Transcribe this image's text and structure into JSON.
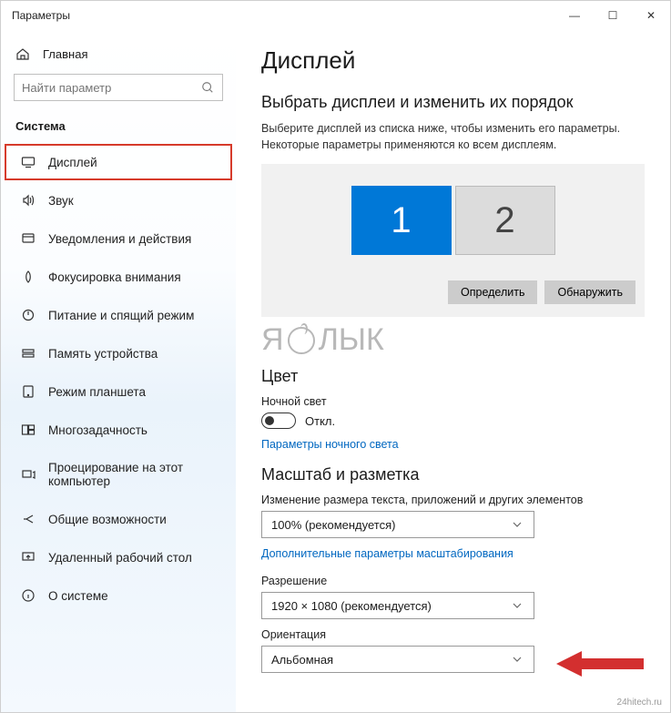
{
  "window": {
    "title": "Параметры"
  },
  "titlebar_buttons": {
    "min": "—",
    "max": "☐",
    "close": "✕"
  },
  "sidebar": {
    "home": "Главная",
    "search_placeholder": "Найти параметр",
    "section": "Система",
    "items": [
      {
        "label": "Дисплей",
        "icon": "display-icon",
        "active": true
      },
      {
        "label": "Звук",
        "icon": "sound-icon"
      },
      {
        "label": "Уведомления и действия",
        "icon": "notifications-icon"
      },
      {
        "label": "Фокусировка внимания",
        "icon": "focus-icon"
      },
      {
        "label": "Питание и спящий режим",
        "icon": "power-icon"
      },
      {
        "label": "Память устройства",
        "icon": "storage-icon"
      },
      {
        "label": "Режим планшета",
        "icon": "tablet-icon"
      },
      {
        "label": "Многозадачность",
        "icon": "multitask-icon"
      },
      {
        "label": "Проецирование на этот компьютер",
        "icon": "projecting-icon"
      },
      {
        "label": "Общие возможности",
        "icon": "shared-icon"
      },
      {
        "label": "Удаленный рабочий стол",
        "icon": "remote-icon"
      },
      {
        "label": "О системе",
        "icon": "about-icon"
      }
    ]
  },
  "main": {
    "heading": "Дисплей",
    "arrange_heading": "Выбрать дисплеи и изменить их порядок",
    "arrange_text": "Выберите дисплей из списка ниже, чтобы изменить его параметры. Некоторые параметры применяются ко всем дисплеям.",
    "monitor1": "1",
    "monitor2": "2",
    "identify": "Определить",
    "detect": "Обнаружить",
    "watermark": "ЯБЛЫК",
    "color_heading": "Цвет",
    "night_light_label": "Ночной свет",
    "night_light_state": "Откл.",
    "night_link": "Параметры ночного света",
    "scale_heading": "Масштаб и разметка",
    "scale_label": "Изменение размера текста, приложений и других элементов",
    "scale_value": "100% (рекомендуется)",
    "scale_link": "Дополнительные параметры масштабирования",
    "resolution_label": "Разрешение",
    "resolution_value": "1920 × 1080 (рекомендуется)",
    "orientation_label": "Ориентация",
    "orientation_value": "Альбомная"
  },
  "footer": "24hitech.ru"
}
